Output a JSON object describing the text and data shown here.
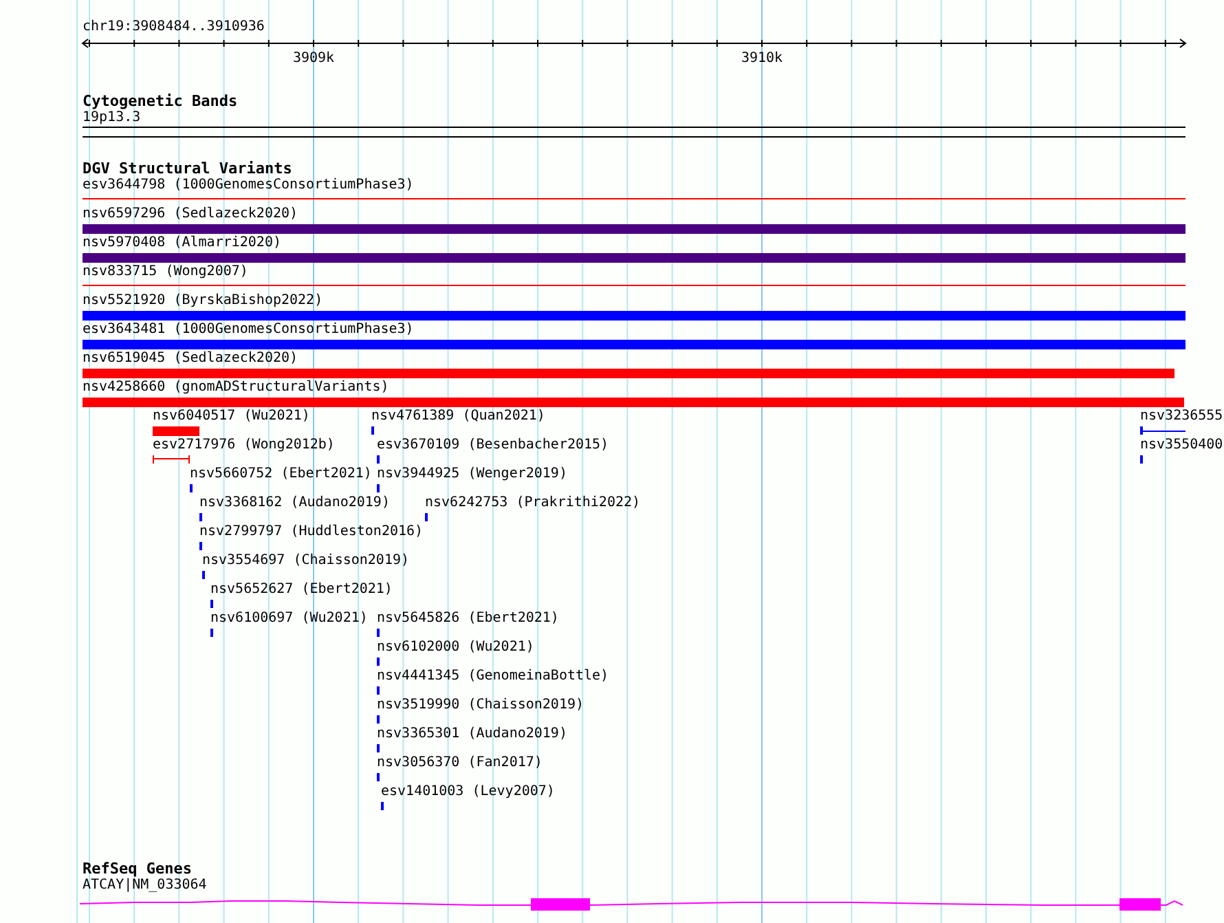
{
  "ruler": {
    "location": "chr19:3908484..3910936",
    "tick_labels": [
      "3909k",
      "3910k"
    ]
  },
  "tracks": [
    {
      "title": "Cytogenetic Bands",
      "kind": "bands",
      "bands": [
        {
          "label": "19p13.3"
        }
      ]
    },
    {
      "title": "DGV Structural Variants",
      "kind": "variants",
      "features": [
        {
          "label": "esv3644798 (1000GenomesConsortiumPhase3)",
          "kind": "line",
          "color": "#ff0000"
        },
        {
          "label": "nsv6597296 (Sedlazeck2020)",
          "kind": "bar",
          "color": "#4b0082"
        },
        {
          "label": "nsv5970408 (Almarri2020)",
          "kind": "bar",
          "color": "#4b0082"
        },
        {
          "label": "nsv833715 (Wong2007)",
          "kind": "line",
          "color": "#ff0000"
        },
        {
          "label": "nsv5521920 (ByrskaBishop2022)",
          "kind": "bar",
          "color": "#0000ff"
        },
        {
          "label": "esv3643481 (1000GenomesConsortiumPhase3)",
          "kind": "bar",
          "color": "#0000ff"
        },
        {
          "label": "nsv6519045 (Sedlazeck2020)",
          "kind": "bar",
          "color": "#ff0000"
        },
        {
          "label": "nsv4258660 (gnomADStructuralVariants)",
          "kind": "bar",
          "color": "#ff0000"
        },
        {
          "label": "nsv6040517 (Wu2021)",
          "kind": "bar",
          "color": "#ff0000"
        },
        {
          "label": "nsv4761389 (Quan2021)",
          "kind": "tick",
          "color": "#0000ff"
        },
        {
          "label": "nsv3236555",
          "kind": "tick-line",
          "color": "#0000ff"
        },
        {
          "label": "esv2717976 (Wong2012b)",
          "kind": "capped",
          "color": "#ff0000"
        },
        {
          "label": "esv3670109 (Besenbacher2015)",
          "kind": "tick",
          "color": "#0000ff"
        },
        {
          "label": "nsv3550400",
          "kind": "tick",
          "color": "#0000ff"
        },
        {
          "label": "nsv5660752 (Ebert2021)",
          "kind": "tick",
          "color": "#0000ff"
        },
        {
          "label": "nsv3944925 (Wenger2019)",
          "kind": "tick",
          "color": "#0000ff"
        },
        {
          "label": "nsv3368162 (Audano2019)",
          "kind": "tick",
          "color": "#0000ff"
        },
        {
          "label": "nsv6242753 (Prakrithi2022)",
          "kind": "tick",
          "color": "#0000ff"
        },
        {
          "label": "nsv2799797 (Huddleston2016)",
          "kind": "tick",
          "color": "#0000ff"
        },
        {
          "label": "nsv3554697 (Chaisson2019)",
          "kind": "tick",
          "color": "#0000ff"
        },
        {
          "label": "nsv5652627 (Ebert2021)",
          "kind": "tick",
          "color": "#0000ff"
        },
        {
          "label": "nsv6100697 (Wu2021)",
          "kind": "tick",
          "color": "#0000ff"
        },
        {
          "label": "nsv5645826 (Ebert2021)",
          "kind": "tick",
          "color": "#0000ff"
        },
        {
          "label": "nsv6102000 (Wu2021)",
          "kind": "tick",
          "color": "#0000ff"
        },
        {
          "label": "nsv4441345 (GenomeinaBottle)",
          "kind": "tick",
          "color": "#0000ff"
        },
        {
          "label": "nsv3519990 (Chaisson2019)",
          "kind": "tick",
          "color": "#0000ff"
        },
        {
          "label": "nsv3365301 (Audano2019)",
          "kind": "tick",
          "color": "#0000ff"
        },
        {
          "label": "nsv3056370 (Fan2017)",
          "kind": "tick",
          "color": "#0000ff"
        },
        {
          "label": "esv1401003 (Levy2007)",
          "kind": "tick",
          "color": "#0000ff"
        }
      ]
    },
    {
      "title": "RefSeq Genes",
      "kind": "genes",
      "genes": [
        {
          "label": "ATCAY|NM_033064"
        }
      ]
    }
  ]
}
